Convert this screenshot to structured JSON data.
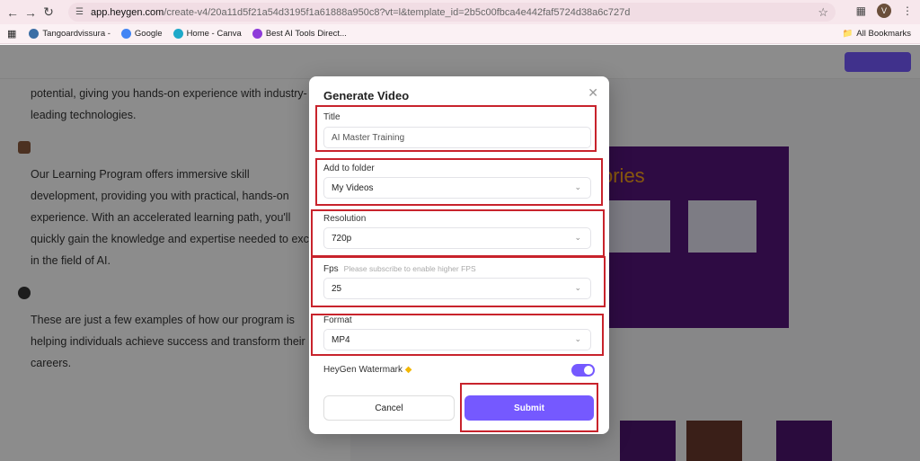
{
  "browser": {
    "url_host": "app.heygen.com",
    "url_rest": "/create-v4/20a11d5f21a54d3195f1a61888a950c8?vt=l&template_id=2b5c00fbca4e442faf5724d38a6c727d",
    "profile_initial": "V",
    "bookmarks": [
      "Tangoardvissura -",
      "Google",
      "Home - Canva",
      "Best AI Tools Direct..."
    ],
    "all_bookmarks": "All Bookmarks"
  },
  "background": {
    "paragraphs": [
      "potential, giving you hands-on experience with industry-leading technologies.",
      "Our Learning Program offers immersive skill development, providing you with practical, hands-on experience. With an accelerated learning path, you'll quickly gain the knowledge and expertise needed to excel in the field of AI.",
      "These are just a few examples of how our program is helping individuals achieve success and transform their careers."
    ],
    "slide_title": "ories"
  },
  "modal": {
    "title": "Generate Video",
    "fields": {
      "title_label": "Title",
      "title_value": "AI Master Training",
      "folder_label": "Add to folder",
      "folder_value": "My Videos",
      "resolution_label": "Resolution",
      "resolution_value": "720p",
      "fps_label": "Fps",
      "fps_hint": "Please subscribe to enable higher FPS",
      "fps_value": "25",
      "format_label": "Format",
      "format_value": "MP4"
    },
    "watermark_label": "HeyGen Watermark",
    "watermark_on": true,
    "cancel_label": "Cancel",
    "submit_label": "Submit"
  },
  "colors": {
    "accent": "#7559ff",
    "annotation": "#c8232c"
  }
}
